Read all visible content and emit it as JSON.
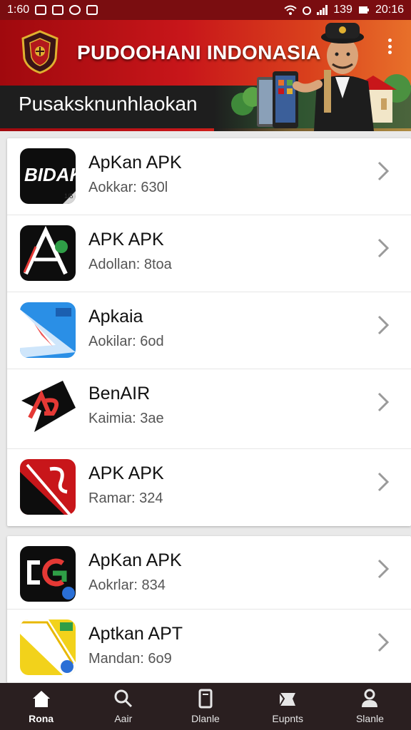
{
  "status_bar": {
    "time_left": "1:60",
    "time_right": "20:16",
    "battery": "139"
  },
  "header": {
    "title": "PUDOOHANI INDONASIA",
    "subtitle": "Pusaksknunhlaokan"
  },
  "list_primary": [
    {
      "title": "ApKan APK",
      "subtitle": "Aokkar: 630l",
      "icon": "bidak-app-icon"
    },
    {
      "title": "APK APK",
      "subtitle": "Adollan: 8toa",
      "icon": "a-logo-app-icon"
    },
    {
      "title": "Apkaia",
      "subtitle": "Aokilar: 6od",
      "icon": "paper-plane-app-icon"
    },
    {
      "title": "BenAIR",
      "subtitle": "Kaimia: 3ae",
      "icon": "ap-arrow-app-icon"
    },
    {
      "title": "APK APK",
      "subtitle": "Ramar: 324",
      "icon": "red-swoosh-app-icon"
    }
  ],
  "list_secondary": [
    {
      "title": "ApKan APK",
      "subtitle": "Aokrlar: 834",
      "icon": "colorful-g-app-icon"
    },
    {
      "title": "Aptkan APT",
      "subtitle": "Mandan: 6o9",
      "icon": "yellow-folder-app-icon"
    }
  ],
  "bottom_nav": [
    {
      "label": "Rona",
      "icon": "home-icon",
      "active": true
    },
    {
      "label": "Aair",
      "icon": "search-icon",
      "active": false
    },
    {
      "label": "Dlanle",
      "icon": "document-icon",
      "active": false
    },
    {
      "label": "Eupnts",
      "icon": "box-icon",
      "active": false
    },
    {
      "label": "Slanle",
      "icon": "profile-icon",
      "active": false
    }
  ],
  "colors": {
    "header_red": "#c8161a",
    "status_bar": "#7a0d10",
    "nav_bg": "#2a1f20"
  }
}
